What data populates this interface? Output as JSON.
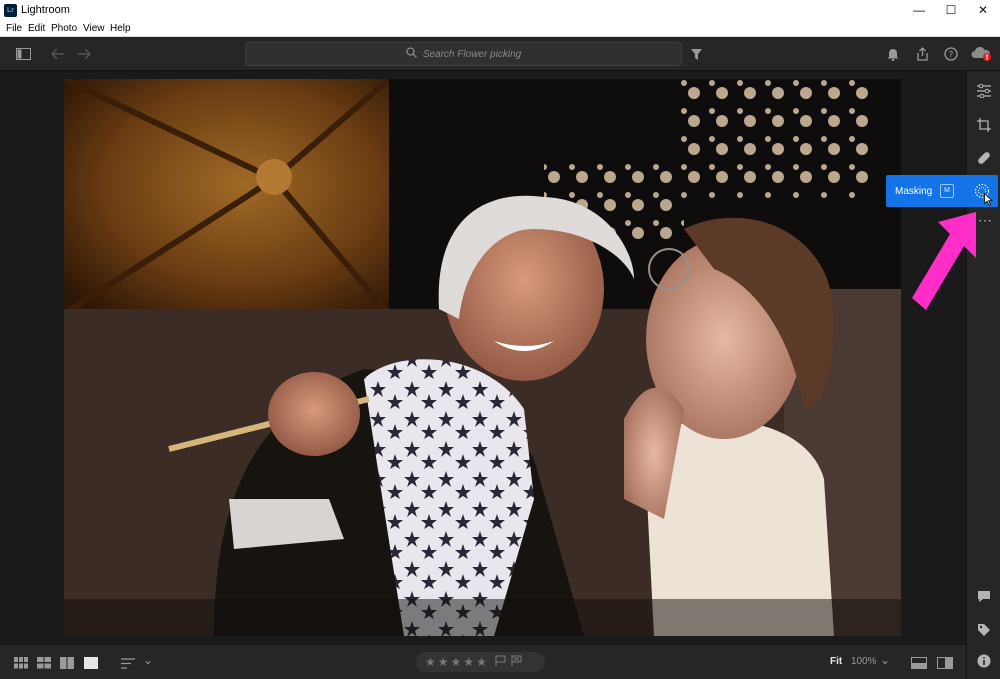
{
  "window": {
    "app_logo": "Lr",
    "title": "Lightroom",
    "minimize": "—",
    "maximize": "☐",
    "close": "✕"
  },
  "menu": [
    "File",
    "Edit",
    "Photo",
    "View",
    "Help"
  ],
  "toolbar": {
    "search_placeholder": "Search Flower picking",
    "icons": [
      "panel-toggle-icon",
      "back-arrow-icon",
      "forward-arrow-icon",
      "filter-icon",
      "bell-icon",
      "share-icon",
      "help-icon",
      "cloud-sync-icon"
    ]
  },
  "masking_tooltip": {
    "label": "Masking",
    "shortcut": "M"
  },
  "rail": {
    "icons": [
      "edit-sliders-icon",
      "crop-icon",
      "healing-icon",
      "masking-icon",
      "more-icon",
      "comments-icon",
      "keywords-icon",
      "info-icon"
    ],
    "more": "⋯"
  },
  "bottom": {
    "view_icons": [
      "square-grid-icon",
      "photo-grid-icon",
      "compare-icon",
      "detail-view-icon"
    ],
    "stars": [
      "★",
      "★",
      "★",
      "★",
      "★"
    ],
    "fit_label": "Fit",
    "zoom_label": "100%",
    "zoom_chevron": "⌄",
    "sort_chevron": "⌄"
  },
  "colors": {
    "accent": "#1473e6",
    "arrow": "#ff2ec8",
    "chrome": "#262626",
    "canvas": "#1a1a1a"
  }
}
